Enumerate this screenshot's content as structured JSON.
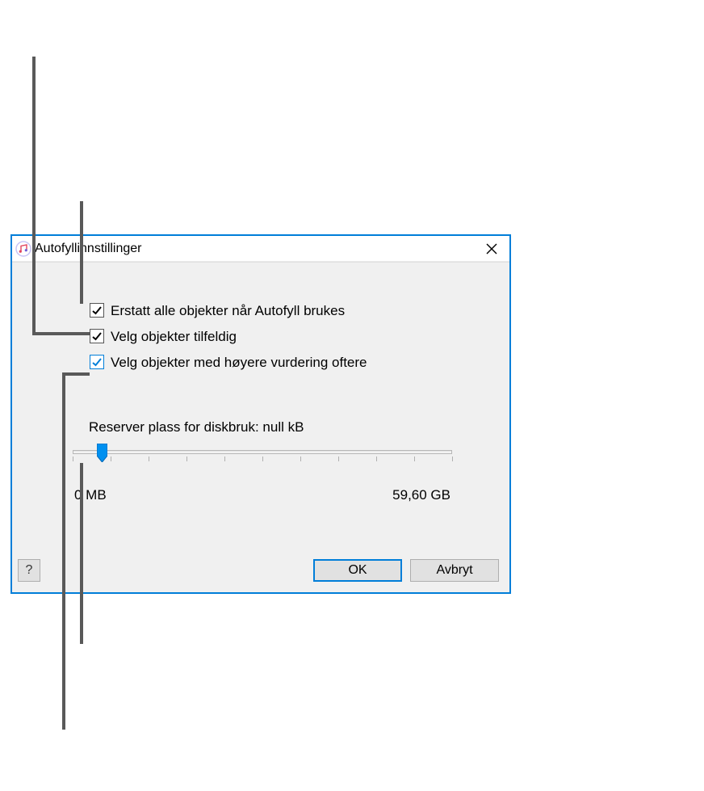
{
  "window": {
    "title": "Autofyllinnstillinger"
  },
  "options": {
    "replace_all": {
      "label": "Erstatt alle objekter når Autofyll brukes",
      "checked": true
    },
    "random": {
      "label": "Velg objekter tilfeldig",
      "checked": true
    },
    "higher_rated": {
      "label": "Velg objekter med høyere vurdering oftere",
      "checked": true
    }
  },
  "slider": {
    "label": "Reserver plass for diskbruk: null kB",
    "min_label": "0 MB",
    "max_label": "59,60 GB"
  },
  "buttons": {
    "help": "?",
    "ok": "OK",
    "cancel": "Avbryt"
  }
}
